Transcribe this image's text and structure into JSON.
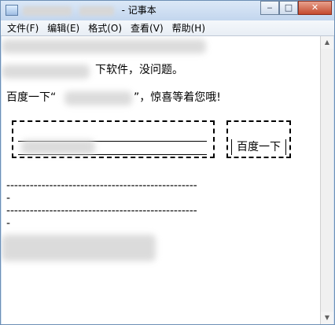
{
  "window": {
    "title_suffix": "- 记事本",
    "controls": {
      "minimize": "‒",
      "maximize": "□",
      "close": "✕"
    }
  },
  "menu": [
    "文件(F)",
    "编辑(E)",
    "格式(O)",
    "查看(V)",
    "帮助(H)"
  ],
  "content": {
    "line2_suffix": "下软件，没问题。",
    "line3_prefix": "百度一下“",
    "line3_suffix": "”，惊喜等着您哦!",
    "button_label": "百度一下",
    "dash_top": "-------------------------------------------------",
    "dash_mid": "-------------------------------------------------",
    "dash_end_1": "-",
    "dash_end_2": "-"
  },
  "scrollbar": {
    "up_arrow": "▲",
    "down_arrow": "▼"
  }
}
